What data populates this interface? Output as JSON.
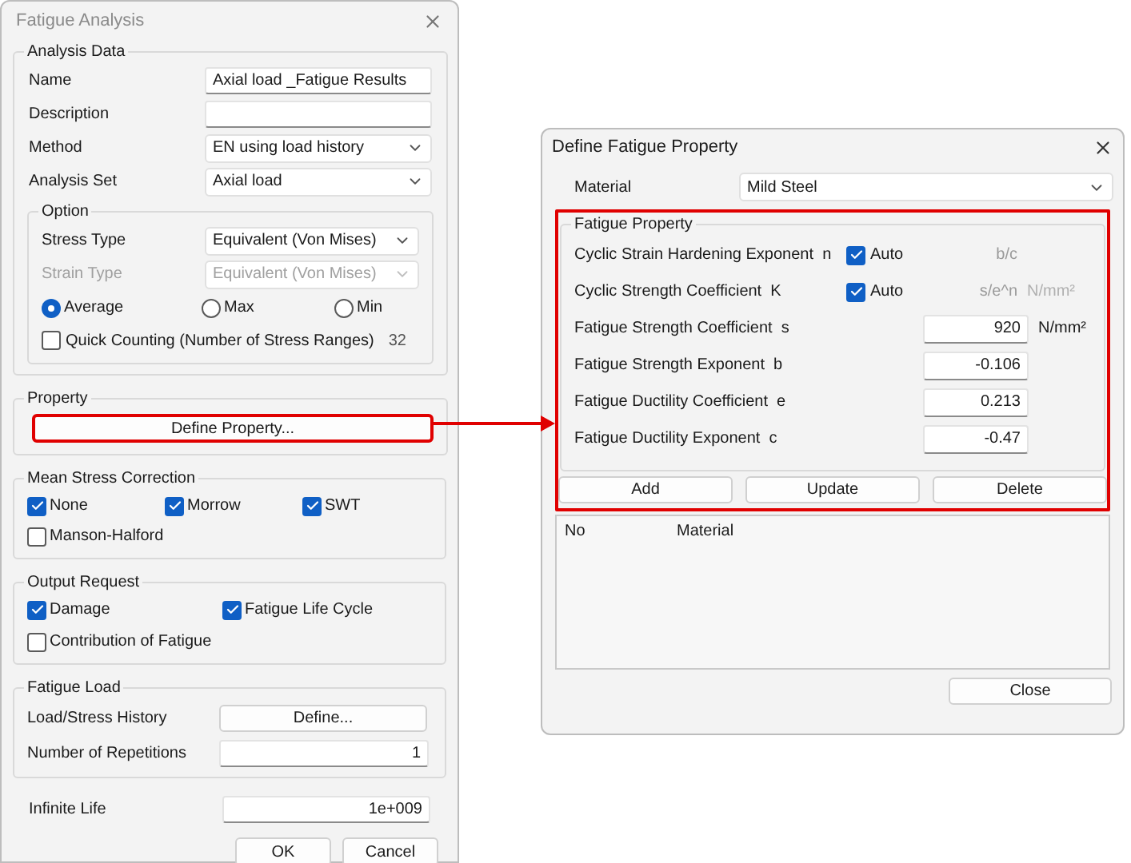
{
  "fatigue_analysis": {
    "title": "Fatigue Analysis",
    "analysis_data": {
      "label": "Analysis Data",
      "fields": [
        {
          "label": "Name",
          "kind": "text",
          "value": "Axial load _Fatigue Results"
        },
        {
          "label": "Description",
          "kind": "text"
        },
        {
          "label": "Method",
          "kind": "select",
          "value": "EN using load history"
        },
        {
          "label": "Analysis Set",
          "kind": "select",
          "value": "Axial load"
        }
      ],
      "option": {
        "label": "Option",
        "fields": [
          {
            "label": "Stress Type",
            "value": "Equivalent (Von Mises)",
            "disabled": false
          },
          {
            "label": "Strain Type",
            "value": "Equivalent (Von Mises)",
            "disabled": true
          }
        ],
        "radios": [
          {
            "label": "Average",
            "selected": true
          },
          {
            "label": "Max",
            "selected": false
          },
          {
            "label": "Min",
            "selected": false
          }
        ],
        "quick_counting": {
          "label": "Quick Counting (Number of Stress Ranges)",
          "checked": false,
          "value": "32"
        }
      }
    },
    "property": {
      "label": "Property",
      "button": "Define Property...",
      "highlighted": true
    },
    "mean_stress_correction": {
      "label": "Mean Stress Correction",
      "options": [
        {
          "label": "None",
          "checked": true
        },
        {
          "label": "Morrow",
          "checked": true
        },
        {
          "label": "SWT",
          "checked": true
        },
        {
          "label": "Manson-Halford",
          "checked": false
        }
      ]
    },
    "output_request": {
      "label": "Output Request",
      "options": [
        {
          "label": "Damage",
          "checked": true
        },
        {
          "label": "Fatigue Life Cycle",
          "checked": true
        },
        {
          "label": "Contribution of Fatigue",
          "checked": false
        }
      ]
    },
    "fatigue_load": {
      "label": "Fatigue Load",
      "rows": [
        {
          "label": "Load/Stress History",
          "kind": "button",
          "value": "Define..."
        },
        {
          "label": "Number of Repetitions",
          "kind": "field",
          "value": "1"
        }
      ]
    },
    "infinite_life": {
      "label": "Infinite Life",
      "value": "1e+009"
    },
    "buttons": [
      "OK",
      "Cancel"
    ]
  },
  "define_fatigue_property": {
    "title": "Define Fatigue Property",
    "material": {
      "label": "Material",
      "value": "Mild Steel"
    },
    "fatigue_property": {
      "label": "Fatigue Property",
      "highlighted": true,
      "rows": [
        {
          "label": "Cyclic Strain Hardening Exponent  n",
          "kind": "auto",
          "auto_label": "Auto",
          "checked": true,
          "formula": "b/c"
        },
        {
          "label": "Cyclic Strength Coefficient  K",
          "kind": "auto",
          "auto_label": "Auto",
          "checked": true,
          "formula": "s/e^n",
          "unit": "N/mm²"
        },
        {
          "label": "Fatigue Strength Coefficient  s",
          "kind": "value",
          "value": "920",
          "unit": "N/mm²"
        },
        {
          "label": "Fatigue Strength Exponent  b",
          "kind": "value",
          "value": "-0.106"
        },
        {
          "label": "Fatigue Ductility Coefficient  e",
          "kind": "value",
          "value": "0.213"
        },
        {
          "label": "Fatigue Ductility Exponent  c",
          "kind": "value",
          "value": "-0.47"
        }
      ],
      "buttons": [
        "Add",
        "Update",
        "Delete"
      ]
    },
    "list": {
      "columns": [
        "No",
        "Material"
      ]
    },
    "close_button": "Close"
  }
}
